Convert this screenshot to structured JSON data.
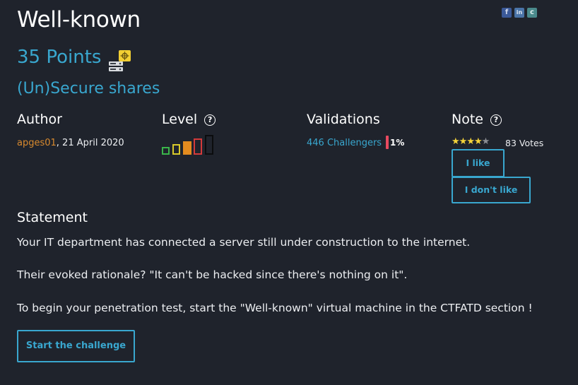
{
  "header": {
    "title": "Well-known",
    "points": "35 Points",
    "category": "(Un)Secure shares"
  },
  "social": {
    "icons": [
      "facebook-icon",
      "linkedin-icon",
      "share-icon"
    ],
    "labels": [
      "f",
      "in",
      "c"
    ]
  },
  "info": {
    "author_label": "Author",
    "author_name": "apges01",
    "author_date": ",  21 April 2020",
    "level_label": "Level",
    "level_help": "?",
    "level_value": 4,
    "level_max": 5,
    "validations_label": "Validations",
    "validations_link": "446 Challengers",
    "validations_pct": "1%",
    "note_label": "Note",
    "note_help": "?",
    "rating": 4,
    "rating_max": 5,
    "votes": "83 Votes"
  },
  "buttons": {
    "like": "I like",
    "dislike": "I don't like",
    "start": "Start the challenge"
  },
  "statement": {
    "heading": "Statement",
    "p1": "Your IT department has connected a server still under construction to the internet.",
    "p2": "Their evoked rationale? \"It can't be hacked since there's nothing on it\".",
    "p3": "To begin your penetration test, start the \"Well-known\" virtual machine in the CTFATD section !"
  },
  "colors": {
    "accent": "#39a7cf",
    "author": "#d98a2e",
    "star": "#f4d33a",
    "validation_bar": "#e84a5f",
    "level_colors": [
      "#3ab54a",
      "#d8c92a",
      "#e38b1f",
      "#d43a3a",
      "#000000"
    ]
  }
}
